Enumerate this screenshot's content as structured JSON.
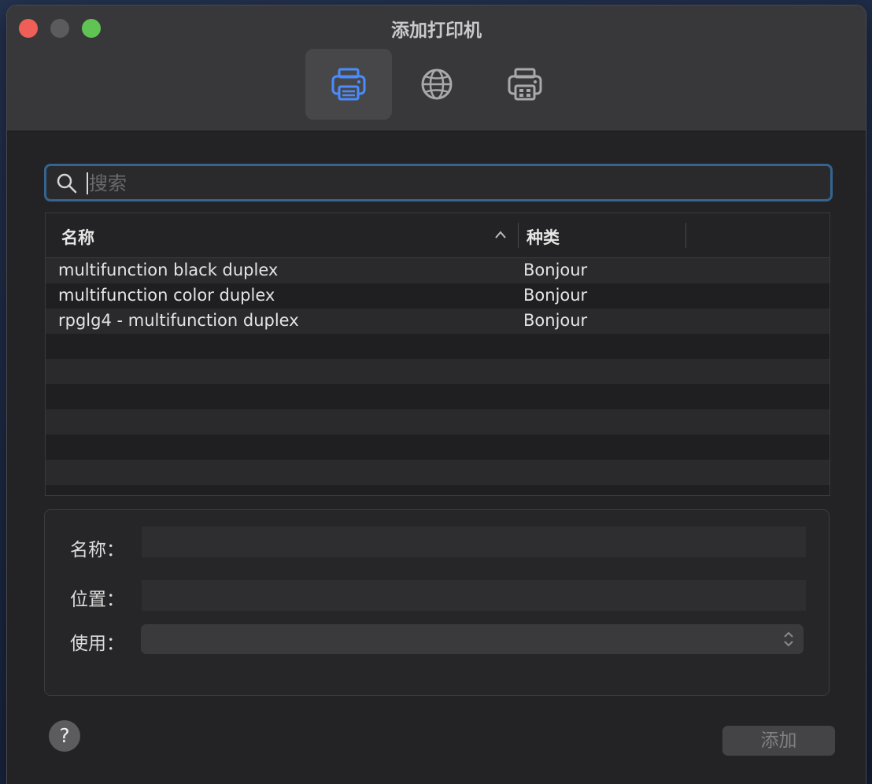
{
  "window": {
    "title": "添加打印机"
  },
  "toolbar": {
    "items": [
      {
        "icon": "printer-icon",
        "selected": true
      },
      {
        "icon": "globe-icon",
        "selected": false
      },
      {
        "icon": "windows-printer-icon",
        "selected": false
      }
    ]
  },
  "search": {
    "placeholder": "搜索",
    "value": ""
  },
  "table": {
    "columns": {
      "name": "名称",
      "kind": "种类"
    },
    "sort": "ascending",
    "rows": [
      {
        "name": "multifunction black duplex",
        "kind": "Bonjour"
      },
      {
        "name": "multifunction color duplex",
        "kind": "Bonjour"
      },
      {
        "name": "rpglg4 - multifunction duplex",
        "kind": "Bonjour"
      }
    ]
  },
  "details": {
    "name_label": "名称：",
    "name_value": "",
    "location_label": "位置：",
    "location_value": "",
    "use_label": "使用：",
    "use_value": ""
  },
  "footer": {
    "help_label": "?",
    "add_label": "添加"
  },
  "colors": {
    "accent": "#4a8cff",
    "close": "#ee5f58",
    "zoom": "#5fc454"
  }
}
